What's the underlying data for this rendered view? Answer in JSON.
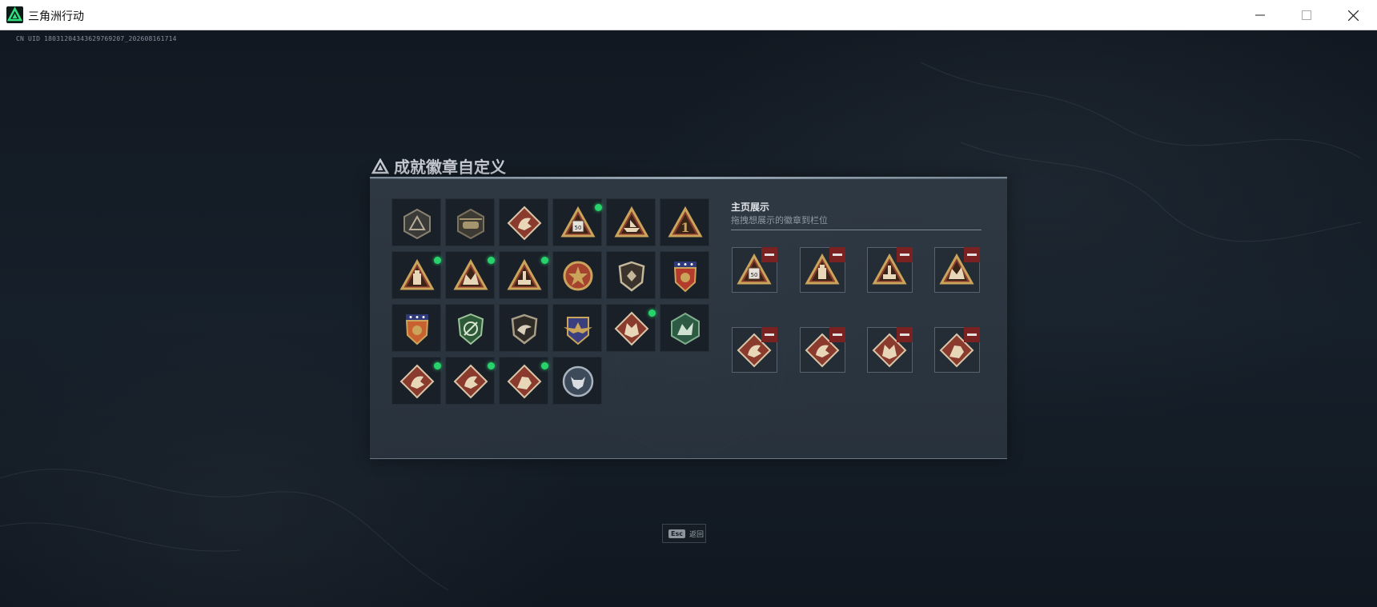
{
  "window": {
    "title": "三角洲行动",
    "controls": [
      "minimize-icon",
      "maximize-icon",
      "close-icon"
    ]
  },
  "uid_text": "CN UID 18031204343629769207_202608161714",
  "dialog": {
    "title": "成就徽章自定义",
    "badges": [
      {
        "icon": "gray-triangle-shield-badge",
        "new": false
      },
      {
        "icon": "helicopter-badge",
        "new": false
      },
      {
        "icon": "gold-triangle-crate-badge",
        "new": false
      },
      {
        "icon": "triangle-50-badge",
        "new": true
      },
      {
        "icon": "triangle-boat-badge",
        "new": false
      },
      {
        "icon": "triangle-number-one-badge",
        "new": false
      },
      {
        "icon": "triangle-bottle-badge",
        "new": true
      },
      {
        "icon": "triangle-beast-badge",
        "new": true
      },
      {
        "icon": "triangle-tower-badge",
        "new": true
      },
      {
        "icon": "star-medal-badge",
        "new": false
      },
      {
        "icon": "shield-emblem-badge",
        "new": false
      },
      {
        "icon": "star-shield-red-badge",
        "new": false
      },
      {
        "icon": "star-shield-orange-badge",
        "new": false
      },
      {
        "icon": "green-wreath-badge",
        "new": false
      },
      {
        "icon": "eagle-shield-badge",
        "new": false
      },
      {
        "icon": "winged-star-badge",
        "new": false
      },
      {
        "icon": "wolf-diamond-badge",
        "new": true
      },
      {
        "icon": "green-beast-hex-badge",
        "new": false
      },
      {
        "icon": "dragon-diamond-badge",
        "new": true
      },
      {
        "icon": "dragon-diamond-badge",
        "new": true
      },
      {
        "icon": "hound-diamond-badge",
        "new": true
      },
      {
        "icon": "bull-circle-badge",
        "new": false
      }
    ],
    "panel": {
      "title": "主页展示",
      "subtitle": "拖拽想展示的徽章到栏位",
      "slots": [
        {
          "icon": "triangle-50-badge"
        },
        {
          "icon": "triangle-bottle-badge"
        },
        {
          "icon": "triangle-tower-badge"
        },
        {
          "icon": "triangle-beast-badge"
        },
        {
          "icon": "dragon-diamond-badge"
        },
        {
          "icon": "dragon-diamond-badge"
        },
        {
          "icon": "wolf-diamond-badge"
        },
        {
          "icon": "hound-diamond-badge"
        }
      ]
    }
  },
  "esc_hint": {
    "key": "Esc",
    "label": "返回"
  },
  "colors": {
    "new_dot": "#27d36a",
    "remove_button": "#7a2222",
    "gold": "#c9a45a"
  }
}
